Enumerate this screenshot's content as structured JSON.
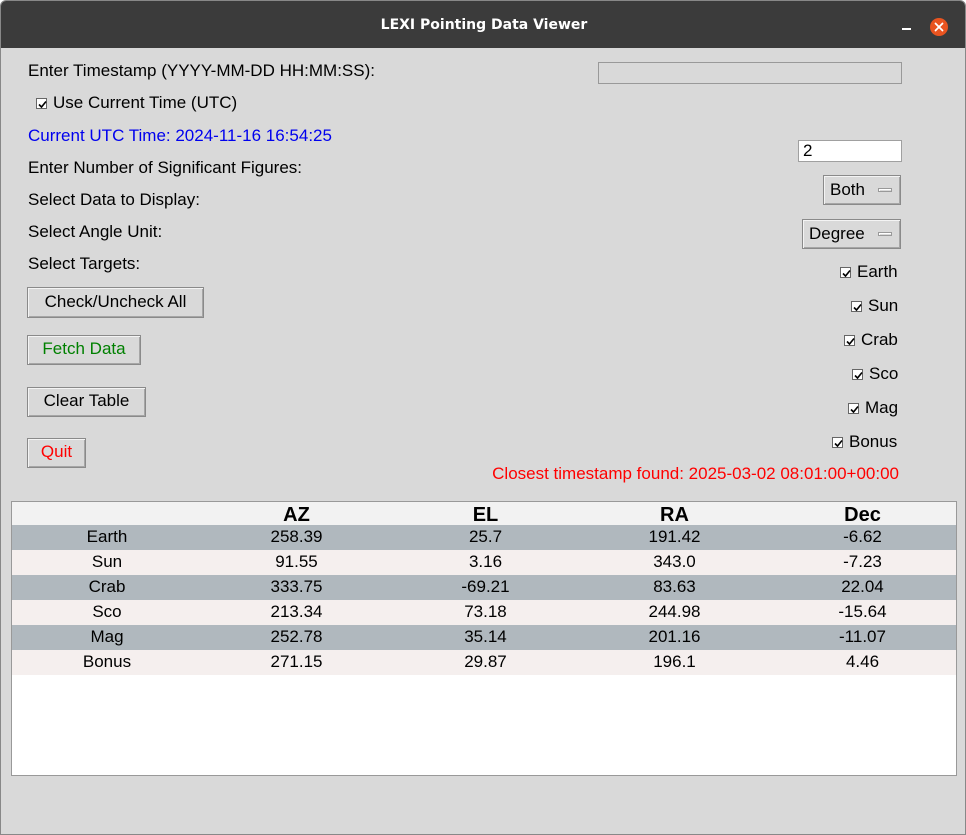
{
  "window": {
    "title": "LEXI Pointing Data Viewer"
  },
  "form": {
    "timestamp_label": "Enter Timestamp (YYYY-MM-DD HH:MM:SS):",
    "timestamp_value": "",
    "use_current_label": "Use Current Time (UTC)",
    "use_current_checked": true,
    "current_utc": "Current UTC Time: 2024-11-16 16:54:25",
    "sigfig_label": "Enter Number of Significant Figures:",
    "sigfig_value": "2",
    "display_label": "Select Data to Display:",
    "display_value": "Both",
    "angle_label": "Select Angle Unit:",
    "angle_value": "Degree",
    "targets_label": "Select Targets:"
  },
  "buttons": {
    "check_all": "Check/Uncheck All",
    "fetch": "Fetch Data",
    "clear": "Clear Table",
    "quit": "Quit"
  },
  "targets": [
    {
      "label": "Earth",
      "checked": true
    },
    {
      "label": "Sun",
      "checked": true
    },
    {
      "label": "Crab",
      "checked": true
    },
    {
      "label": "Sco",
      "checked": true
    },
    {
      "label": "Mag",
      "checked": true
    },
    {
      "label": "Bonus",
      "checked": true
    }
  ],
  "status": {
    "closest": "Closest timestamp found: 2025-03-02 08:01:00+00:00"
  },
  "colors": {
    "utc_text": "#0000ee",
    "fetch_text": "#008000",
    "quit_text": "#ff0000",
    "status_text": "#ff0000",
    "row_dark": "#b0b8be",
    "row_light": "#f5efee"
  },
  "table": {
    "headers": [
      "",
      "AZ",
      "EL",
      "RA",
      "Dec"
    ],
    "rows": [
      [
        "Earth",
        "258.39",
        "25.7",
        "191.42",
        "-6.62"
      ],
      [
        "Sun",
        "91.55",
        "3.16",
        "343.0",
        "-7.23"
      ],
      [
        "Crab",
        "333.75",
        "-69.21",
        "83.63",
        "22.04"
      ],
      [
        "Sco",
        "213.34",
        "73.18",
        "244.98",
        "-15.64"
      ],
      [
        "Mag",
        "252.78",
        "35.14",
        "201.16",
        "-11.07"
      ],
      [
        "Bonus",
        "271.15",
        "29.87",
        "196.1",
        "4.46"
      ]
    ]
  }
}
